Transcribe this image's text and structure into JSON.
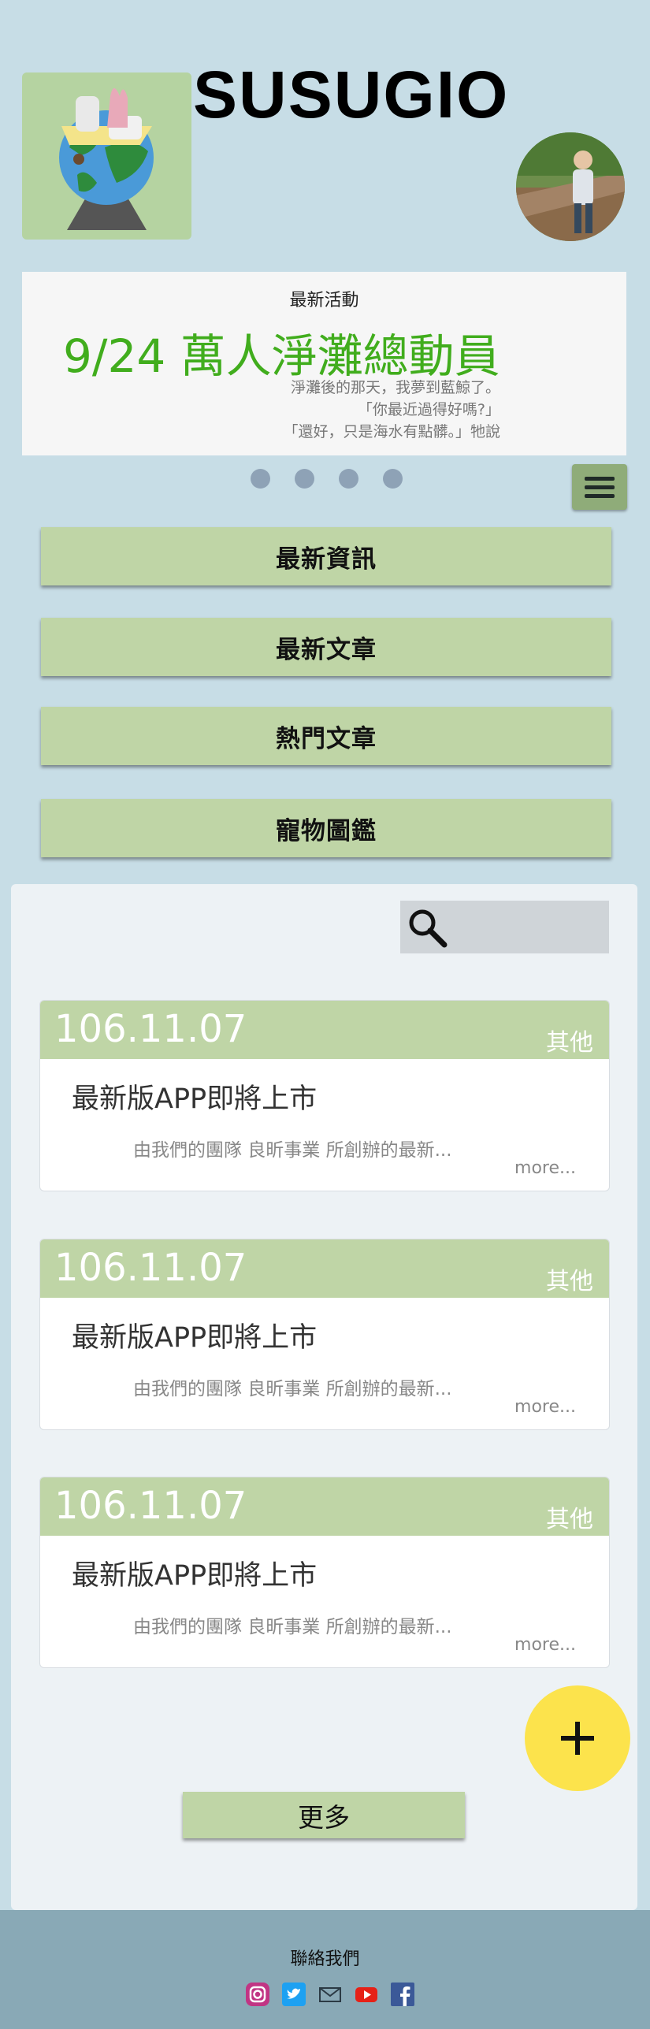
{
  "header": {
    "app_title": "SUSUGIO"
  },
  "banner": {
    "label": "最新活動",
    "headline": "9/24 萬人淨灘總動員",
    "lines": [
      "淨灘後的那天，我夢到藍鯨了。",
      "「你最近過得好嗎?」",
      "「還好，只是海水有點髒。」牠說"
    ]
  },
  "carousel": {
    "dot_count": 4
  },
  "nav": {
    "items": [
      "最新資訊",
      "最新文章",
      "熱門文章",
      "寵物圖鑑"
    ]
  },
  "posts": [
    {
      "date": "106.11.07",
      "category": "其他",
      "title": "最新版APP即將上市",
      "excerpt": "由我們的團隊 良昕事業 所創辦的最新...",
      "more": "more..."
    },
    {
      "date": "106.11.07",
      "category": "其他",
      "title": "最新版APP即將上市",
      "excerpt": "由我們的團隊 良昕事業 所創辦的最新...",
      "more": "more..."
    },
    {
      "date": "106.11.07",
      "category": "其他",
      "title": "最新版APP即將上市",
      "excerpt": "由我們的團隊 良昕事業 所創辦的最新...",
      "more": "more..."
    }
  ],
  "load_more": "更多",
  "footer": {
    "title": "聯絡我們",
    "social": [
      "instagram-icon",
      "twitter-icon",
      "mail-icon",
      "youtube-icon",
      "facebook-icon"
    ]
  },
  "colors": {
    "background": "#c7dde6",
    "accent_green": "#bfd5a6",
    "headline_green": "#41ad1d",
    "fab_yellow": "#fce34c",
    "footer": "#89a9b6"
  }
}
